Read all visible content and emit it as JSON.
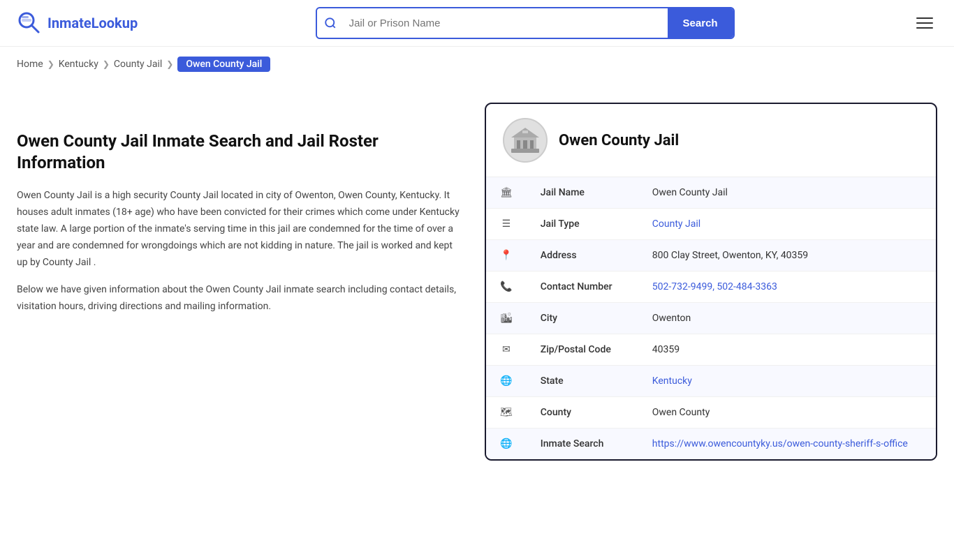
{
  "header": {
    "logo_name": "InmateLookup",
    "logo_prefix": "Inmate",
    "logo_suffix": "Lookup",
    "search_placeholder": "Jail or Prison Name",
    "search_button_label": "Search"
  },
  "breadcrumb": {
    "items": [
      {
        "label": "Home",
        "href": "#"
      },
      {
        "label": "Kentucky",
        "href": "#"
      },
      {
        "label": "County Jail",
        "href": "#"
      },
      {
        "label": "Owen County Jail",
        "current": true
      }
    ],
    "chevron": "❯"
  },
  "left": {
    "heading": "Owen County Jail Inmate Search and Jail Roster Information",
    "para1": "Owen County Jail is a high security County Jail located in city of Owenton, Owen County, Kentucky. It houses adult inmates (18+ age) who have been convicted for their crimes which come under Kentucky state law. A large portion of the inmate's serving time in this jail are condemned for the time of over a year and are condemned for wrongdoings which are not kidding in nature. The jail is worked and kept up by County Jail .",
    "para2": "Below we have given information about the Owen County Jail inmate search including contact details, visitation hours, driving directions and mailing information."
  },
  "card": {
    "title": "Owen County Jail",
    "rows": [
      {
        "icon": "🏛",
        "label": "Jail Name",
        "value": "Owen County Jail",
        "link": null
      },
      {
        "icon": "☰",
        "label": "Jail Type",
        "value": "County Jail",
        "link": "#"
      },
      {
        "icon": "📍",
        "label": "Address",
        "value": "800 Clay Street, Owenton, KY, 40359",
        "link": null
      },
      {
        "icon": "📞",
        "label": "Contact Number",
        "value": "502-732-9499, 502-484-3363",
        "link": "#"
      },
      {
        "icon": "🏙",
        "label": "City",
        "value": "Owenton",
        "link": null
      },
      {
        "icon": "✉",
        "label": "Zip/Postal Code",
        "value": "40359",
        "link": null
      },
      {
        "icon": "🌐",
        "label": "State",
        "value": "Kentucky",
        "link": "#"
      },
      {
        "icon": "🗺",
        "label": "County",
        "value": "Owen County",
        "link": null
      },
      {
        "icon": "🌐",
        "label": "Inmate Search",
        "value": "https://www.owencountyky.us/owen-county-sheriff-s-office",
        "link": "https://www.owencountyky.us/owen-county-sheriff-s-office"
      }
    ]
  }
}
